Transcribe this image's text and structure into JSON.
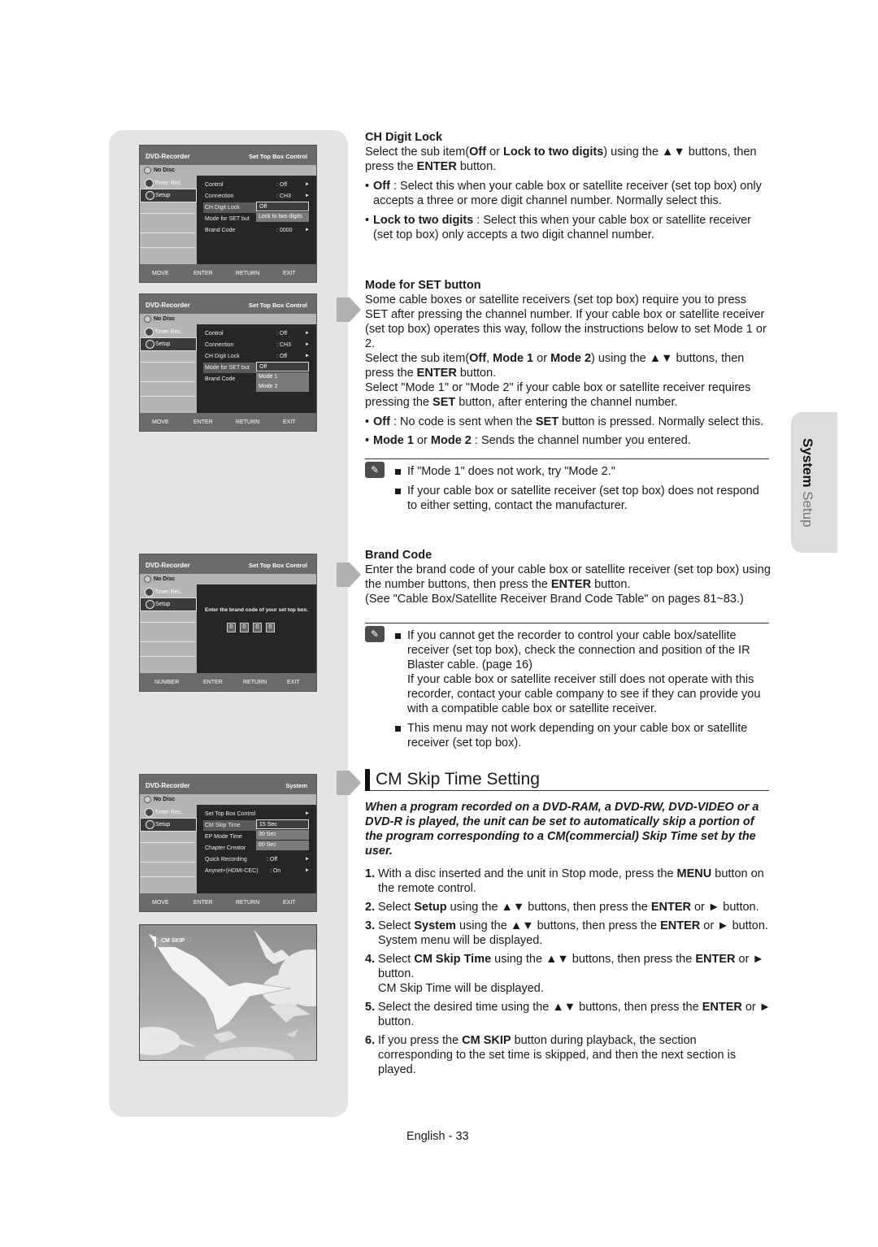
{
  "side_tab": {
    "bold": "System",
    "rest": " Setup"
  },
  "osd_common": {
    "brand": "DVD-Recorder",
    "disc": "No Disc",
    "side_items": [
      "Timer Rec.",
      "Setup"
    ],
    "footer_move": [
      "MOVE",
      "ENTER",
      "RETURN",
      "EXIT"
    ],
    "footer_number": [
      "NUMBER",
      "ENTER",
      "RETURN",
      "EXIT"
    ]
  },
  "osd1": {
    "title": "Set Top Box Control",
    "rows": [
      {
        "k": "Control",
        "v": ": Off"
      },
      {
        "k": "Connection",
        "v": ": CH3"
      },
      {
        "k": "CH Digit Lock",
        "v": ""
      },
      {
        "k": "Mode for SET but",
        "v": ""
      },
      {
        "k": "Brand Code",
        "v": ": 0000"
      }
    ],
    "popup": [
      "Off",
      "Lock to two digits"
    ]
  },
  "osd2": {
    "title": "Set Top Box Control",
    "rows": [
      {
        "k": "Control",
        "v": ": Off"
      },
      {
        "k": "Connection",
        "v": ": CH3"
      },
      {
        "k": "CH Digit Lock",
        "v": ": Off"
      },
      {
        "k": "Mode for SET but",
        "v": ""
      },
      {
        "k": "Brand Code",
        "v": ""
      }
    ],
    "popup": [
      "Off",
      "Mode 1",
      "Mode 2"
    ]
  },
  "osd3": {
    "title": "Set Top Box Control",
    "message": "Enter the brand code of your set top box.",
    "digits": [
      "0",
      "0",
      "0",
      "0"
    ]
  },
  "osd4": {
    "title": "System",
    "rows": [
      {
        "k": "Set Top Box Control",
        "v": ""
      },
      {
        "k": "CM Skip Time",
        "v": ""
      },
      {
        "k": "EP Mode Time",
        "v": ""
      },
      {
        "k": "Chapter Creator",
        "v": ""
      },
      {
        "k": "Quick Recording",
        "v": ": Off"
      },
      {
        "k": "Anynet+(HDMI-CEC)",
        "v": ": On"
      }
    ],
    "popup": [
      "15 Sec",
      "30 Sec",
      "60 Sec"
    ]
  },
  "photo": {
    "label": "CM SKIP"
  },
  "ch_digit_lock": {
    "heading": "CH Digit Lock",
    "p1": [
      "Select the sub item(",
      "Off",
      " or ",
      "Lock to two digits",
      ") using the ▲▼ buttons, then press the ",
      "ENTER",
      " button."
    ],
    "b1": [
      "Off",
      " : Select this when your cable box or satellite receiver (set top box) only accepts a three or more digit channel number. Normally select this."
    ],
    "b2": [
      "Lock to two digits",
      " : Select this when your cable box or satellite receiver (set top box) only accepts a two digit channel number."
    ]
  },
  "mode_for_set": {
    "heading": "Mode for SET button",
    "p1": "Some cable boxes or satellite receivers (set top box) require you to press SET after pressing the channel number. If your cable box or satellite receiver (set top box) operates this way, follow the instructions below to set Mode 1 or 2.",
    "p2": [
      "Select the sub item(",
      "Off",
      ", ",
      "Mode 1",
      " or ",
      "Mode 2",
      ") using the ▲▼ buttons, then press the ",
      "ENTER",
      " button."
    ],
    "p3": [
      "Select \"Mode 1\" or \"Mode 2\" if your cable box or satellite receiver requires pressing the ",
      "SET",
      " button, after entering the channel number."
    ],
    "b1": [
      "Off",
      " : No code is sent when the ",
      "SET",
      " button is pressed. Normally select this."
    ],
    "b2": [
      "Mode 1",
      " or ",
      "Mode 2",
      " : Sends the channel number you entered."
    ]
  },
  "note1": [
    "If \"Mode 1\" does not work, try \"Mode 2.\"",
    "If your cable box or satellite receiver (set top box) does not respond to either setting, contact the manufacturer."
  ],
  "brand_code": {
    "heading": "Brand Code",
    "p1": [
      "Enter the brand code of your cable box or satellite receiver (set top box) using the number buttons, then press the ",
      "ENTER",
      " button."
    ],
    "p2": "(See \"Cable Box/Satellite Receiver Brand Code Table\" on pages 81~83.)"
  },
  "note2": [
    "If you cannot get the recorder to control your cable box/satellite receiver (set top box), check the connection and position of the IR Blaster cable. (page 16)\nIf your cable box or satellite receiver still does not operate with this recorder, contact your cable company to see if they can provide you with a compatible cable box or satellite receiver.",
    "This menu may not work depending on your cable box or satellite receiver (set top box)."
  ],
  "cm_skip": {
    "title": "CM Skip Time Setting",
    "intro": "When a program recorded on a DVD-RAM, a DVD-RW, DVD-VIDEO or a DVD-R is played, the unit can be set to automatically skip a portion of the program corresponding to a CM(commercial) Skip Time set by the user.",
    "steps": [
      {
        "n": "1.",
        "parts": [
          "With a disc inserted and the unit in Stop mode, press the ",
          "MENU",
          " button on the remote control."
        ]
      },
      {
        "n": "2.",
        "parts": [
          "Select ",
          "Setup",
          " using the ▲▼ buttons, then press the ",
          "ENTER",
          " or ► button."
        ]
      },
      {
        "n": "3.",
        "parts": [
          "Select ",
          "System",
          " using the ▲▼ buttons, then press the ",
          "ENTER",
          " or ► button.\nSystem menu will be displayed."
        ]
      },
      {
        "n": "4.",
        "parts": [
          "Select ",
          "CM Skip Time",
          " using the ▲▼ buttons, then press the ",
          "ENTER",
          " or ► button.\nCM Skip Time will be displayed."
        ]
      },
      {
        "n": "5.",
        "parts": [
          "Select the desired time using the ▲▼ buttons, then press the ",
          "ENTER",
          " or ► button."
        ]
      },
      {
        "n": "6.",
        "parts": [
          "If you press the ",
          "CM SKIP",
          " button during playback, the section corresponding to the set time is skipped, and then the next section is played."
        ]
      }
    ]
  },
  "footer": "English - 33"
}
